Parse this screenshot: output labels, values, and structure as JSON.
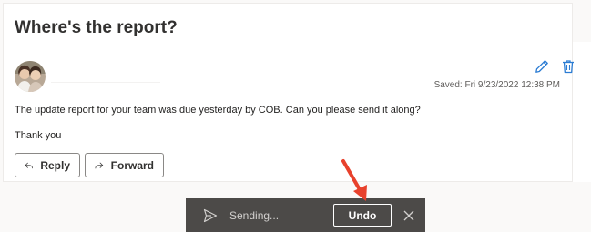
{
  "email": {
    "subject": "Where's the report?",
    "saved_status": "Saved: Fri 9/23/2022 12:38 PM",
    "body": "The update report for your team was due yesterday by COB. Can you please send it along?",
    "signoff": "Thank you"
  },
  "actions": {
    "reply_label": "Reply",
    "forward_label": "Forward"
  },
  "toast": {
    "status": "Sending...",
    "undo_label": "Undo"
  },
  "icons": {
    "edit": "pencil-icon",
    "delete": "trash-icon",
    "reply": "reply-arrow-icon",
    "forward": "forward-arrow-icon",
    "send": "send-icon",
    "close": "close-icon"
  },
  "colors": {
    "accent": "#0078d4",
    "toast_bg": "#4c4a48",
    "annotation": "#e8412c"
  }
}
